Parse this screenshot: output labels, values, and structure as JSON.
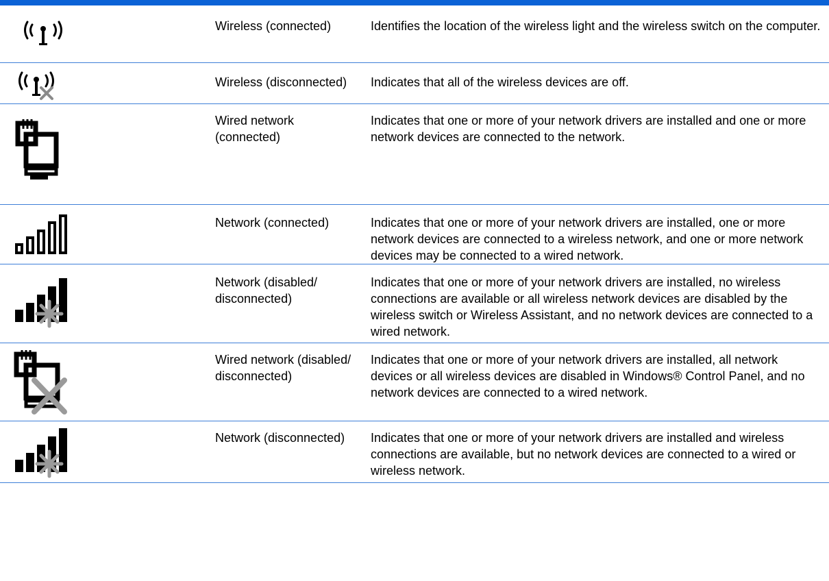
{
  "rows": [
    {
      "icon": "wireless-connected-icon",
      "name": "Wireless (connected)",
      "description": "Identifies the location of the wireless light and the wireless switch on the computer."
    },
    {
      "icon": "wireless-disconnected-icon",
      "name": "Wireless (disconnected)",
      "description": "Indicates that all of the wireless devices are off."
    },
    {
      "icon": "wired-network-connected-icon",
      "name": "Wired network (connected)",
      "description": "Indicates that one or more of your network drivers are installed and one or more network devices are connected to the network."
    },
    {
      "icon": "network-connected-icon",
      "name": "Network (connected)",
      "description": "Indicates that one or more of your network drivers are installed, one or more network devices are connected to a wireless network, and one or more network devices may be connected to a wired network."
    },
    {
      "icon": "network-disabled-disconnected-icon",
      "name": "Network (disabled/ disconnected)",
      "description": "Indicates that one or more of your network drivers are installed, no wireless connections are available or all wireless network devices are disabled by the wireless switch or Wireless Assistant, and no network devices are connected to a wired network."
    },
    {
      "icon": "wired-network-disabled-disconnected-icon",
      "name": "Wired network (disabled/ disconnected)",
      "description": "Indicates that one or more of your network drivers are installed, all network devices or all wireless devices are disabled in Windows® Control Panel, and no network devices are connected to a wired network."
    },
    {
      "icon": "network-disconnected-icon",
      "name": "Network (disconnected)",
      "description": "Indicates that one or more of your network drivers are installed and wireless connections are available, but no network devices are connected to a wired or wireless network."
    }
  ]
}
